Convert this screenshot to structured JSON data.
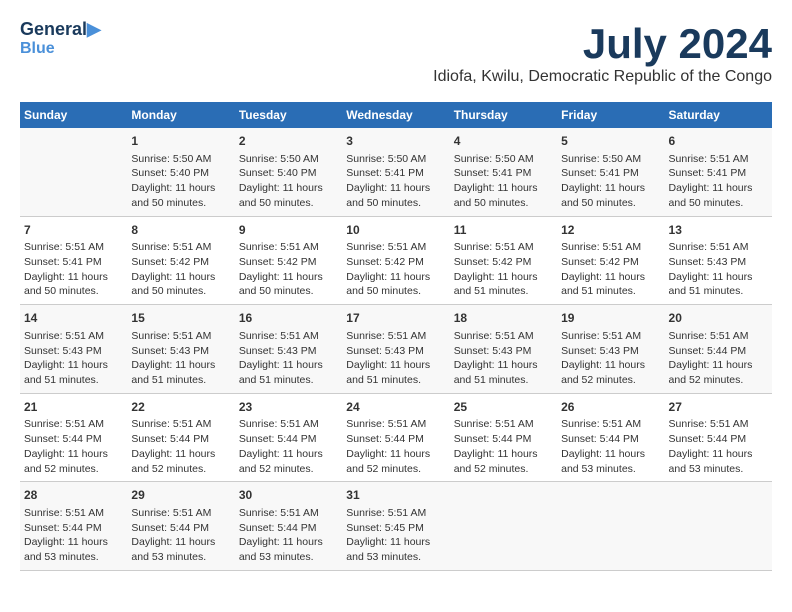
{
  "header": {
    "logo_line1": "General",
    "logo_line2": "Blue",
    "main_title": "July 2024",
    "subtitle": "Idiofa, Kwilu, Democratic Republic of the Congo"
  },
  "days_of_week": [
    "Sunday",
    "Monday",
    "Tuesday",
    "Wednesday",
    "Thursday",
    "Friday",
    "Saturday"
  ],
  "weeks": [
    [
      {
        "day": "",
        "sunrise": "",
        "sunset": "",
        "daylight": ""
      },
      {
        "day": "1",
        "sunrise": "Sunrise: 5:50 AM",
        "sunset": "Sunset: 5:40 PM",
        "daylight": "Daylight: 11 hours and 50 minutes."
      },
      {
        "day": "2",
        "sunrise": "Sunrise: 5:50 AM",
        "sunset": "Sunset: 5:40 PM",
        "daylight": "Daylight: 11 hours and 50 minutes."
      },
      {
        "day": "3",
        "sunrise": "Sunrise: 5:50 AM",
        "sunset": "Sunset: 5:41 PM",
        "daylight": "Daylight: 11 hours and 50 minutes."
      },
      {
        "day": "4",
        "sunrise": "Sunrise: 5:50 AM",
        "sunset": "Sunset: 5:41 PM",
        "daylight": "Daylight: 11 hours and 50 minutes."
      },
      {
        "day": "5",
        "sunrise": "Sunrise: 5:50 AM",
        "sunset": "Sunset: 5:41 PM",
        "daylight": "Daylight: 11 hours and 50 minutes."
      },
      {
        "day": "6",
        "sunrise": "Sunrise: 5:51 AM",
        "sunset": "Sunset: 5:41 PM",
        "daylight": "Daylight: 11 hours and 50 minutes."
      }
    ],
    [
      {
        "day": "7",
        "sunrise": "Sunrise: 5:51 AM",
        "sunset": "Sunset: 5:41 PM",
        "daylight": "Daylight: 11 hours and 50 minutes."
      },
      {
        "day": "8",
        "sunrise": "Sunrise: 5:51 AM",
        "sunset": "Sunset: 5:42 PM",
        "daylight": "Daylight: 11 hours and 50 minutes."
      },
      {
        "day": "9",
        "sunrise": "Sunrise: 5:51 AM",
        "sunset": "Sunset: 5:42 PM",
        "daylight": "Daylight: 11 hours and 50 minutes."
      },
      {
        "day": "10",
        "sunrise": "Sunrise: 5:51 AM",
        "sunset": "Sunset: 5:42 PM",
        "daylight": "Daylight: 11 hours and 50 minutes."
      },
      {
        "day": "11",
        "sunrise": "Sunrise: 5:51 AM",
        "sunset": "Sunset: 5:42 PM",
        "daylight": "Daylight: 11 hours and 51 minutes."
      },
      {
        "day": "12",
        "sunrise": "Sunrise: 5:51 AM",
        "sunset": "Sunset: 5:42 PM",
        "daylight": "Daylight: 11 hours and 51 minutes."
      },
      {
        "day": "13",
        "sunrise": "Sunrise: 5:51 AM",
        "sunset": "Sunset: 5:43 PM",
        "daylight": "Daylight: 11 hours and 51 minutes."
      }
    ],
    [
      {
        "day": "14",
        "sunrise": "Sunrise: 5:51 AM",
        "sunset": "Sunset: 5:43 PM",
        "daylight": "Daylight: 11 hours and 51 minutes."
      },
      {
        "day": "15",
        "sunrise": "Sunrise: 5:51 AM",
        "sunset": "Sunset: 5:43 PM",
        "daylight": "Daylight: 11 hours and 51 minutes."
      },
      {
        "day": "16",
        "sunrise": "Sunrise: 5:51 AM",
        "sunset": "Sunset: 5:43 PM",
        "daylight": "Daylight: 11 hours and 51 minutes."
      },
      {
        "day": "17",
        "sunrise": "Sunrise: 5:51 AM",
        "sunset": "Sunset: 5:43 PM",
        "daylight": "Daylight: 11 hours and 51 minutes."
      },
      {
        "day": "18",
        "sunrise": "Sunrise: 5:51 AM",
        "sunset": "Sunset: 5:43 PM",
        "daylight": "Daylight: 11 hours and 51 minutes."
      },
      {
        "day": "19",
        "sunrise": "Sunrise: 5:51 AM",
        "sunset": "Sunset: 5:43 PM",
        "daylight": "Daylight: 11 hours and 52 minutes."
      },
      {
        "day": "20",
        "sunrise": "Sunrise: 5:51 AM",
        "sunset": "Sunset: 5:44 PM",
        "daylight": "Daylight: 11 hours and 52 minutes."
      }
    ],
    [
      {
        "day": "21",
        "sunrise": "Sunrise: 5:51 AM",
        "sunset": "Sunset: 5:44 PM",
        "daylight": "Daylight: 11 hours and 52 minutes."
      },
      {
        "day": "22",
        "sunrise": "Sunrise: 5:51 AM",
        "sunset": "Sunset: 5:44 PM",
        "daylight": "Daylight: 11 hours and 52 minutes."
      },
      {
        "day": "23",
        "sunrise": "Sunrise: 5:51 AM",
        "sunset": "Sunset: 5:44 PM",
        "daylight": "Daylight: 11 hours and 52 minutes."
      },
      {
        "day": "24",
        "sunrise": "Sunrise: 5:51 AM",
        "sunset": "Sunset: 5:44 PM",
        "daylight": "Daylight: 11 hours and 52 minutes."
      },
      {
        "day": "25",
        "sunrise": "Sunrise: 5:51 AM",
        "sunset": "Sunset: 5:44 PM",
        "daylight": "Daylight: 11 hours and 52 minutes."
      },
      {
        "day": "26",
        "sunrise": "Sunrise: 5:51 AM",
        "sunset": "Sunset: 5:44 PM",
        "daylight": "Daylight: 11 hours and 53 minutes."
      },
      {
        "day": "27",
        "sunrise": "Sunrise: 5:51 AM",
        "sunset": "Sunset: 5:44 PM",
        "daylight": "Daylight: 11 hours and 53 minutes."
      }
    ],
    [
      {
        "day": "28",
        "sunrise": "Sunrise: 5:51 AM",
        "sunset": "Sunset: 5:44 PM",
        "daylight": "Daylight: 11 hours and 53 minutes."
      },
      {
        "day": "29",
        "sunrise": "Sunrise: 5:51 AM",
        "sunset": "Sunset: 5:44 PM",
        "daylight": "Daylight: 11 hours and 53 minutes."
      },
      {
        "day": "30",
        "sunrise": "Sunrise: 5:51 AM",
        "sunset": "Sunset: 5:44 PM",
        "daylight": "Daylight: 11 hours and 53 minutes."
      },
      {
        "day": "31",
        "sunrise": "Sunrise: 5:51 AM",
        "sunset": "Sunset: 5:45 PM",
        "daylight": "Daylight: 11 hours and 53 minutes."
      },
      {
        "day": "",
        "sunrise": "",
        "sunset": "",
        "daylight": ""
      },
      {
        "day": "",
        "sunrise": "",
        "sunset": "",
        "daylight": ""
      },
      {
        "day": "",
        "sunrise": "",
        "sunset": "",
        "daylight": ""
      }
    ]
  ]
}
